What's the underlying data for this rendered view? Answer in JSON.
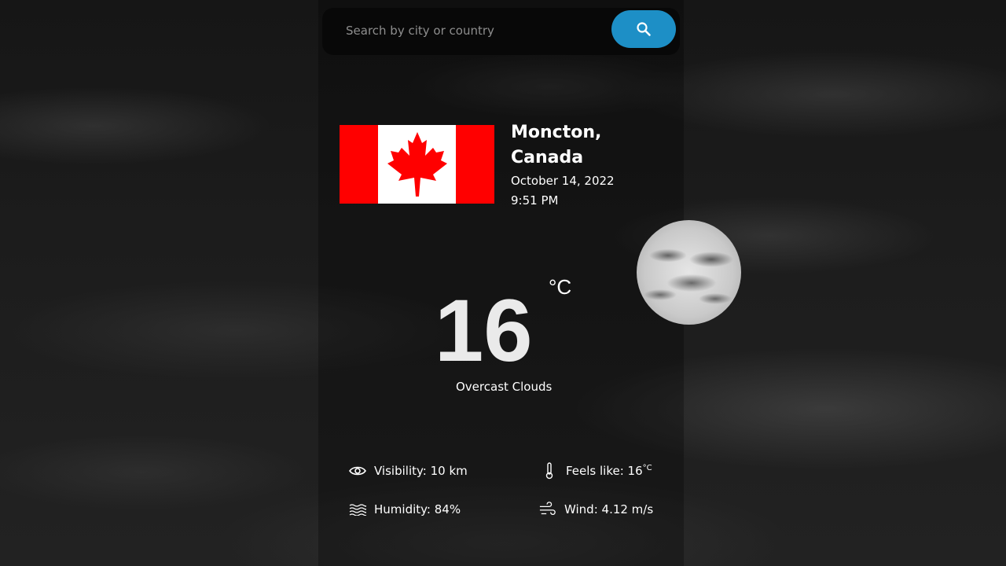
{
  "search": {
    "placeholder": "Search by city or country",
    "value": "",
    "button_icon": "search-icon"
  },
  "location": {
    "city": "Moncton,",
    "country": "Canada",
    "flag": "canada-flag",
    "date": "October 14, 2022",
    "time": "9:51 PM"
  },
  "weather": {
    "temperature": "16",
    "unit": "°C",
    "description": "Overcast Clouds",
    "icon": "moon-clouds-icon"
  },
  "details": {
    "visibility": "Visibility: 10 km",
    "feels_like": "Feels like: 16",
    "feels_like_unit": "°C",
    "humidity": "Humidity: 84%",
    "wind": "Wind: 4.12 m/s"
  },
  "colors": {
    "accent": "#1d8fc6",
    "flag_red": "#ff0000"
  }
}
